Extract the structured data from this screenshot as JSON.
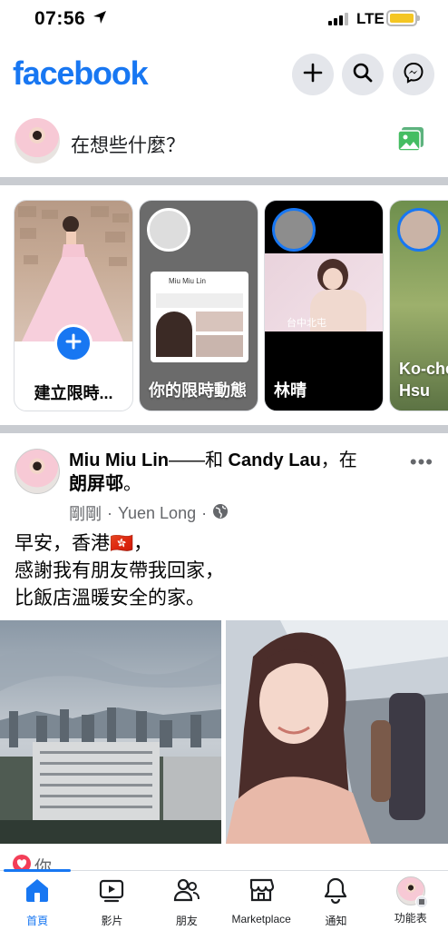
{
  "status_bar": {
    "time": "07:56",
    "carrier": "LTE",
    "battery_color": "#f4c623"
  },
  "header": {
    "logo": "facebook",
    "brand_color": "#1877f2",
    "icons": [
      "plus-icon",
      "search-icon",
      "messenger-icon"
    ]
  },
  "composer": {
    "placeholder": "在想些什麼？"
  },
  "stories": [
    {
      "label": "建立限時..."
    },
    {
      "label": "你的限時動態",
      "card_title": "Miu Miu Lin"
    },
    {
      "label": "林晴",
      "overlay_text": "台中北屯"
    },
    {
      "label": "Ko-che Hsu"
    }
  ],
  "post": {
    "author": "Miu Miu Lin",
    "connector": "——和 ",
    "with": "Candy Lau",
    "in_text": "，在",
    "location": "朗屏邨",
    "period": "。",
    "time": "剛剛",
    "place": "Yuen Long",
    "text_lines": [
      "早安，香港🇭🇰，",
      "感謝我有朋友帶我回家，",
      "比飯店溫暖安全的家。"
    ]
  },
  "reactions": {
    "label": "你"
  },
  "bottom_nav": [
    {
      "label": "首頁",
      "icon": "home-icon",
      "active": true
    },
    {
      "label": "影片",
      "icon": "video-icon"
    },
    {
      "label": "朋友",
      "icon": "friends-icon"
    },
    {
      "label": "Marketplace",
      "icon": "marketplace-icon"
    },
    {
      "label": "通知",
      "icon": "bell-icon"
    },
    {
      "label": "功能表",
      "icon": "menu-avatar-icon"
    }
  ]
}
